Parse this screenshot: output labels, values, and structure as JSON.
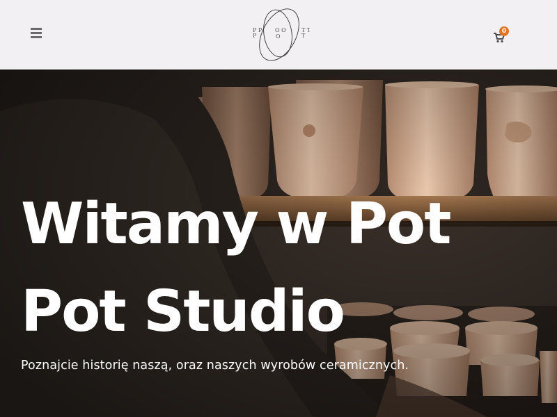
{
  "header": {
    "menu_icon": "hamburger-menu-icon",
    "logo_letters": {
      "left": "P P",
      "middle": "O O",
      "right": "T T"
    },
    "cart_icon": "shopping-cart-icon",
    "cart_count": "0",
    "colors": {
      "background": "#f2f0f3",
      "badge": "#e0762a",
      "icon": "#6a6a6a"
    }
  },
  "hero": {
    "title_line1": "Witamy w Pot",
    "title_line2": "Pot Studio",
    "subtitle": "Poznajcie historię naszą, oraz naszych wyrobów ceramicznych.",
    "background_image": "ceramic-cups-on-shelves-photo",
    "text_color": "#ffffff"
  }
}
